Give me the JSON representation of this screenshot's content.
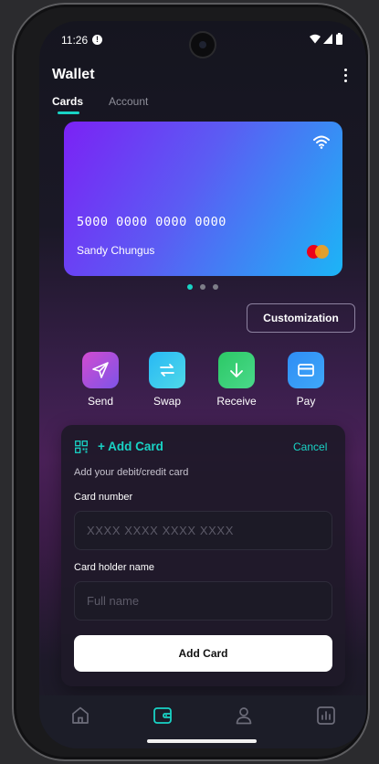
{
  "status_bar": {
    "time": "11:26",
    "alert_glyph": "!"
  },
  "header": {
    "title": "Wallet"
  },
  "tabs": [
    {
      "label": "Cards",
      "active": true
    },
    {
      "label": "Account",
      "active": false
    }
  ],
  "card": {
    "number": "5000 0000 0000 0000",
    "holder": "Sandy Chungus",
    "brand_icon": "mastercard-logo",
    "contactless_icon": "wifi-icon",
    "gradient": [
      "#7b22f5",
      "#1cb5f6"
    ]
  },
  "carousel": {
    "pages": 3,
    "active_index": 0
  },
  "customization": {
    "label": "Customization"
  },
  "actions": [
    {
      "label": "Send",
      "icon": "send-icon",
      "colors": [
        "#d24bd0",
        "#7d54e8"
      ]
    },
    {
      "label": "Swap",
      "icon": "swap-icon",
      "colors": [
        "#28b8f5",
        "#4fd9e8"
      ]
    },
    {
      "label": "Receive",
      "icon": "receive-icon",
      "colors": [
        "#2cc866",
        "#4ad98a"
      ]
    },
    {
      "label": "Pay",
      "icon": "card-icon",
      "colors": [
        "#2f8df5",
        "#3fa8f8"
      ]
    }
  ],
  "add_card": {
    "title": "+ Add Card",
    "cancel": "Cancel",
    "subtitle": "Add your debit/credit card",
    "card_number_label": "Card number",
    "card_number_placeholder": "XXXX XXXX XXXX XXXX",
    "card_number_value": "",
    "holder_label": "Card holder name",
    "holder_placeholder": "Full name",
    "holder_value": "",
    "submit": "Add Card"
  },
  "bottom_nav": [
    {
      "icon": "home-icon",
      "active": false
    },
    {
      "icon": "wallet-icon",
      "active": true
    },
    {
      "icon": "profile-icon",
      "active": false
    },
    {
      "icon": "stats-icon",
      "active": false
    }
  ],
  "colors": {
    "accent": "#19d3c5",
    "card_start": "#7b22f5",
    "card_end": "#1cb5f6"
  }
}
